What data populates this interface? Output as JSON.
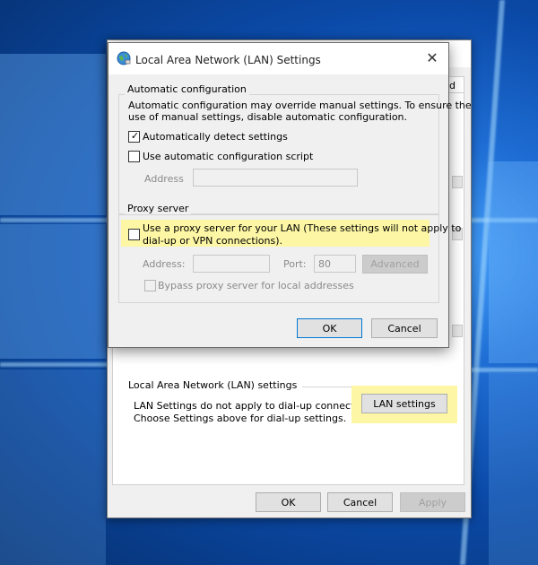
{
  "outer_dialog": {
    "tab_fragment": "d",
    "lan_group_title": "Local Area Network (LAN) settings",
    "lan_note_line1": "LAN Settings do not apply to dial-up connections.",
    "lan_note_line2": "Choose Settings above for dial-up settings.",
    "lan_settings_button": "LAN settings",
    "ok_button": "OK",
    "cancel_button": "Cancel",
    "apply_button": "Apply"
  },
  "lan_dialog": {
    "title": "Local Area Network (LAN) Settings",
    "close_glyph": "✕",
    "auto_config": {
      "legend": "Automatic configuration",
      "description_line1": "Automatic configuration may override manual settings.  To ensure the",
      "description_line2": "use of manual settings, disable automatic configuration.",
      "detect_label": "Automatically detect settings",
      "detect_checked": true,
      "script_label": "Use automatic configuration script",
      "script_checked": false,
      "address_label": "Address",
      "address_value": ""
    },
    "proxy": {
      "legend": "Proxy server",
      "use_proxy_line1": "Use a proxy server for your LAN (These settings will not apply to",
      "use_proxy_line2": "dial-up or VPN connections).",
      "use_proxy_checked": false,
      "address_label": "Address:",
      "address_value": "",
      "port_label": "Port:",
      "port_value": "80",
      "advanced_button": "Advanced",
      "bypass_label": "Bypass proxy server for local addresses",
      "bypass_checked": false
    },
    "ok_button": "OK",
    "cancel_button": "Cancel"
  },
  "colors": {
    "highlight": "#fdf7a5",
    "dialog_bg": "#f0f0f0",
    "accent": "#0078d7"
  },
  "icons": {
    "title_icon": "globe-network-icon",
    "check_mark": "✓"
  }
}
